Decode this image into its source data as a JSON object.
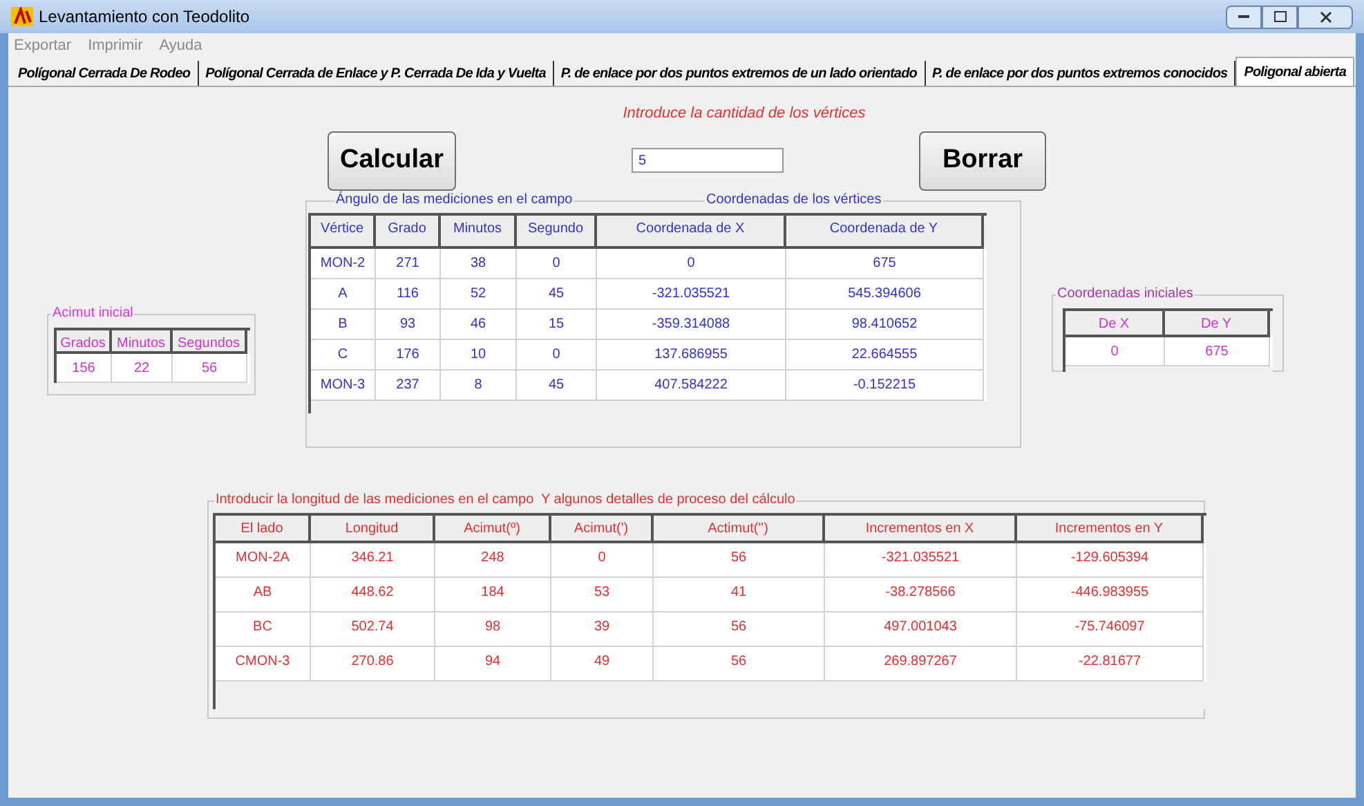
{
  "window": {
    "title": "Levantamiento con Teodolito"
  },
  "menu": [
    "Exportar",
    "Imprimir",
    "Ayuda"
  ],
  "tabs": [
    {
      "label": "Polígonal Cerrada De Rodeo",
      "selected": false
    },
    {
      "label": "Polígonal Cerrada de Enlace y P. Cerrada De Ida y Vuelta",
      "selected": false
    },
    {
      "label": "P. de enlace por dos puntos extremos de un lado orientado",
      "selected": false
    },
    {
      "label": "P. de enlace por dos puntos extremos conocidos",
      "selected": false
    },
    {
      "label": "Poligonal abierta",
      "selected": true
    }
  ],
  "prompt": "Introduce la cantidad de los vértices",
  "calculate_button": "Calcular",
  "vertex_count": "5",
  "clear_button": "Borrar",
  "initial_azimuth": {
    "title": "Acimut inicial",
    "columns": [
      "Grados",
      "Minutos",
      "Segundos"
    ],
    "rows": [
      [
        "156",
        "22",
        "56"
      ]
    ]
  },
  "vertices": {
    "title_left": "Ángulo de las mediciones en el campo",
    "title_right": "Coordenadas de los vértices",
    "columns": [
      "Vértice",
      "Grado",
      "Minutos",
      "Segundo",
      "Coordenada de X",
      "Coordenada de Y"
    ],
    "rows": [
      [
        "MON-2",
        "271",
        "38",
        "0",
        "0",
        "675"
      ],
      [
        "A",
        "116",
        "52",
        "45",
        "-321.035521",
        "545.394606"
      ],
      [
        "B",
        "93",
        "46",
        "15",
        "-359.314088",
        "98.410652"
      ],
      [
        "C",
        "176",
        "10",
        "0",
        "137.686955",
        "22.664555"
      ],
      [
        "MON-3",
        "237",
        "8",
        "45",
        "407.584222",
        "-0.152215"
      ]
    ]
  },
  "initial_coordinates": {
    "title": "Coordenadas iniciales",
    "columns": [
      "De X",
      "De Y"
    ],
    "rows": [
      [
        "0",
        "675"
      ]
    ]
  },
  "sides": {
    "title": "Introducir la longitud de las mediciones en el campo  Y algunos detalles de proceso del cálculo",
    "columns": [
      "El lado",
      "Longitud",
      "Acimut(º)",
      "Acimut(')",
      "Actimut('')",
      "Incrementos en X",
      "Incrementos en Y"
    ],
    "rows": [
      [
        "MON-2A",
        "346.21",
        "248",
        "0",
        "56",
        "-321.035521",
        "-129.605394"
      ],
      [
        "AB",
        "448.62",
        "184",
        "53",
        "41",
        "-38.278566",
        "-446.983955"
      ],
      [
        "BC",
        "502.74",
        "98",
        "39",
        "56",
        "497.001043",
        "-75.746097"
      ],
      [
        "CMON-3",
        "270.86",
        "94",
        "49",
        "56",
        "269.897267",
        "-22.81677"
      ]
    ]
  }
}
